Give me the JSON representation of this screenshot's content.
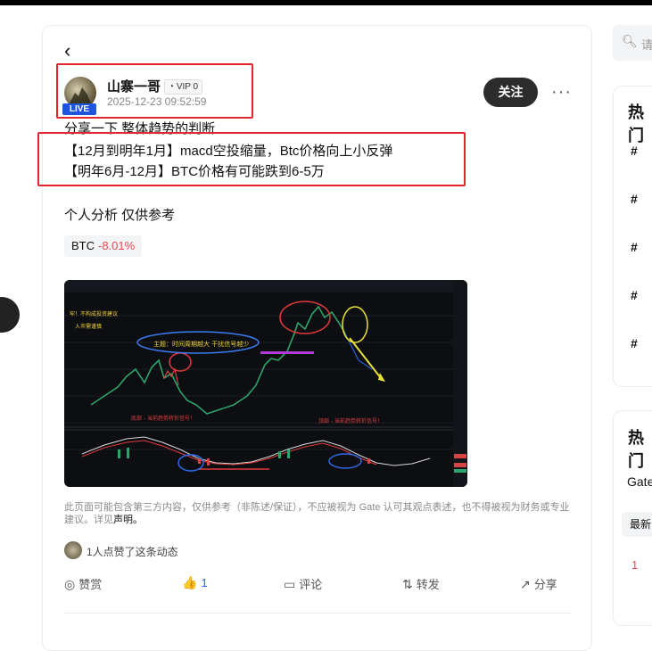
{
  "post": {
    "back_icon": "‹",
    "author": {
      "name": "山寨一哥",
      "vip_badge": "VIP 0",
      "live_badge": "LIVE",
      "timestamp": "2025-12-23 09:52:59"
    },
    "follow_label": "关注",
    "more_label": "···",
    "lines": [
      "分享一下 整体趋势的判断",
      "【12月到明年1月】macd空投缩量，Btc价格向上小反弹",
      "【明年6月-12月】BTC价格有可能跌到6-5万",
      "个人分析 仅供参考"
    ],
    "coin_tag": {
      "symbol": "BTC",
      "change": "-8.01%"
    },
    "disclaimer_text": "此页面可能包含第三方内容，仅供参考（非陈述/保证），不应被视为 Gate 认可其观点表述，也不得被视为财务或专业建议。详见",
    "disclaimer_link": "声明。",
    "liked_by_text": "1人点赞了这条动态",
    "actions": {
      "reward": "赞赏",
      "like_count": "1",
      "comment": "评论",
      "repost": "转发",
      "share": "分享"
    }
  },
  "chart_image": {
    "annotations": [
      "主题：时间周期越大 干扰信号越少",
      "牢！不构成投资建议",
      "入市需谨慎",
      "底部 - 当前趋势转折信号！",
      "顶部 - 当前趋势转折信号！"
    ]
  },
  "sidebar": {
    "search_placeholder": "请",
    "section1_title": "热门",
    "hash_items": [
      "#",
      "#",
      "#",
      "#",
      "#"
    ],
    "section2_title": "热门",
    "tab_label": "Gate",
    "latest_label": "最新",
    "rank_number": "1"
  },
  "colors": {
    "accent": "#2c63f0",
    "negative": "#e5484d",
    "highlight_box": "#e0262f",
    "live_badge": "#1e55e0"
  }
}
